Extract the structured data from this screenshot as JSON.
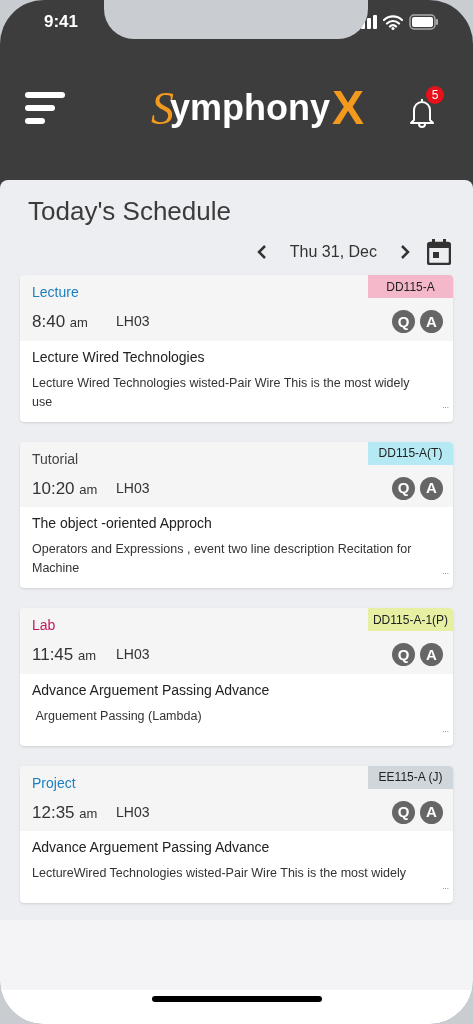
{
  "status_bar": {
    "time": "9:41"
  },
  "header": {
    "logo": {
      "initial": "S",
      "middle": "ymphony",
      "final": "X"
    },
    "notifications": "5"
  },
  "title": "Today's Schedule",
  "date_nav": {
    "date": "Thu 31, Dec"
  },
  "sessions": [
    {
      "type": "Lecture",
      "color": "#1a7fc1",
      "tag": {
        "label": "DD115-A",
        "color": "#f5b8cb"
      },
      "time": "8:40",
      "meridiem": "am",
      "room": "LH03",
      "badges": [
        "Q",
        "A"
      ],
      "subject": "Lecture Wired Technologies",
      "description": "Lecture Wired Technologies wisted-Pair Wire This is the most widely use",
      "more": "..."
    },
    {
      "type": "Tutorial",
      "color": "#444444",
      "tag": {
        "label": "DD115-A(T)",
        "color": "#b5e9f3"
      },
      "time": "10:20",
      "meridiem": "am",
      "room": "LH03",
      "badges": [
        "Q",
        "A"
      ],
      "subject": "The object -oriented Approch",
      "description": "Operators and Expressions , event two line description Recitation for Machine",
      "more": "..."
    },
    {
      "type": "Lab",
      "color": "#c2185b",
      "tag": {
        "label": "DD115-A-1(P)",
        "color": "#e7f0a2"
      },
      "time": "11:45",
      "meridiem": "am",
      "room": "LH03",
      "badges": [
        "Q",
        "A"
      ],
      "subject": "Advance Arguement Passing Advance",
      "description": " Arguement Passing (Lambda)",
      "more": "..."
    },
    {
      "type": "Project",
      "color": "#1a7fc1",
      "tag": {
        "label": "EE115-A (J)",
        "color": "#d0d7dc"
      },
      "time": "12:35",
      "meridiem": "am",
      "room": "LH03",
      "badges": [
        "Q",
        "A"
      ],
      "subject": "Advance Arguement Passing Advance",
      "description": "LectureWired Technologies wisted-Pair Wire This is the most widely",
      "more": "..."
    }
  ]
}
